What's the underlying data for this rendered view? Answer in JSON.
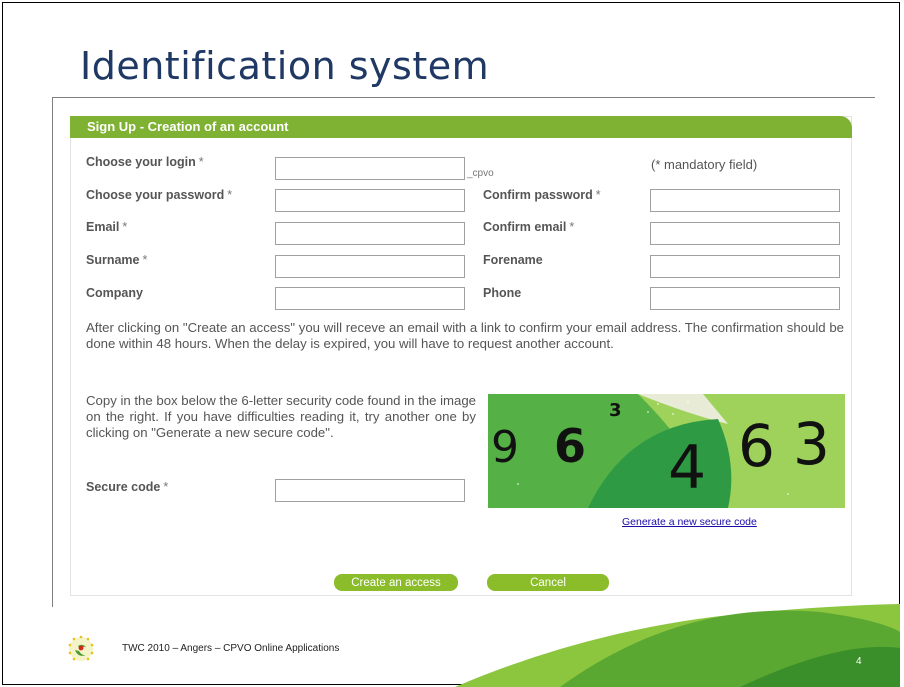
{
  "slide": {
    "title": "Identification system",
    "footer": "TWC 2010 – Angers – CPVO Online Applications",
    "page_number": "4"
  },
  "form": {
    "header": "Sign Up - Creation of an account",
    "login_label": "Choose your login",
    "login_suffix": "_cpvo",
    "mandatory_note": "(* mandatory field)",
    "password_label": "Choose your password",
    "confirm_password_label": "Confirm password",
    "email_label": "Email",
    "confirm_email_label": "Confirm email",
    "surname_label": "Surname",
    "forename_label": "Forename",
    "company_label": "Company",
    "phone_label": "Phone",
    "required_mark": "*",
    "info_paragraph": "After clicking on \"Create an access\" you will receve an email with a link to confirm your email address. The confirmation should be done within 48 hours. When the delay is expired, you will have to request another account.",
    "captcha_instructions": "Copy in the box below the 6-letter security code found in the image on the right. If you have difficulties reading it, try another one by clicking on \"Generate a new secure code\".",
    "secure_code_label": "Secure code",
    "captcha_digits": [
      "9",
      "6",
      "3",
      "4",
      "6",
      "3"
    ],
    "generate_link": "Generate a new secure code",
    "create_button": "Create an access",
    "cancel_button": "Cancel"
  },
  "colors": {
    "title": "#1f3864",
    "header_green": "#7fb233",
    "button_green": "#8bbc2a"
  },
  "icons": {
    "logo": "cpvo-logo-icon"
  }
}
